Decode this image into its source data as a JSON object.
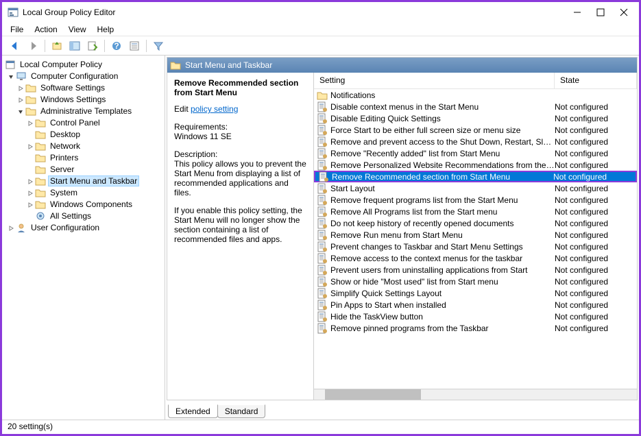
{
  "window": {
    "title": "Local Group Policy Editor"
  },
  "menu": {
    "file": "File",
    "action": "Action",
    "view": "View",
    "help": "Help"
  },
  "tree": {
    "root": "Local Computer Policy",
    "computer_config": "Computer Configuration",
    "software_settings": "Software Settings",
    "windows_settings": "Windows Settings",
    "admin_templates": "Administrative Templates",
    "control_panel": "Control Panel",
    "desktop": "Desktop",
    "network": "Network",
    "printers": "Printers",
    "server": "Server",
    "start_menu_taskbar": "Start Menu and Taskbar",
    "system": "System",
    "windows_components": "Windows Components",
    "all_settings": "All Settings",
    "user_config": "User Configuration"
  },
  "header": {
    "title": "Start Menu and Taskbar"
  },
  "desc": {
    "title": "Remove Recommended section from Start Menu",
    "edit_label": "Edit ",
    "edit_link": "policy setting",
    "req_label": "Requirements:",
    "req_value": "Windows 11 SE",
    "desc_label": "Description:",
    "desc_value": "This policy allows you to prevent the Start Menu from displaying a list of recommended applications and files.",
    "desc_value2": "If you enable this policy setting, the Start Menu will no longer show the section containing a list of recommended files and apps."
  },
  "columns": {
    "setting": "Setting",
    "state": "State"
  },
  "rows": [
    {
      "type": "folder",
      "setting": "Notifications",
      "state": ""
    },
    {
      "type": "policy",
      "setting": "Disable context menus in the Start Menu",
      "state": "Not configured"
    },
    {
      "type": "policy",
      "setting": "Disable Editing Quick Settings",
      "state": "Not configured"
    },
    {
      "type": "policy",
      "setting": "Force Start to be either full screen size or menu size",
      "state": "Not configured"
    },
    {
      "type": "policy",
      "setting": "Remove and prevent access to the Shut Down, Restart, Sleep...",
      "state": "Not configured"
    },
    {
      "type": "policy",
      "setting": "Remove \"Recently added\" list from Start Menu",
      "state": "Not configured"
    },
    {
      "type": "policy",
      "setting": "Remove Personalized Website Recommendations from the ...",
      "state": "Not configured"
    },
    {
      "type": "policy",
      "setting": "Remove Recommended section from Start Menu",
      "state": "Not configured",
      "selected": true
    },
    {
      "type": "policy",
      "setting": "Start Layout",
      "state": "Not configured"
    },
    {
      "type": "policy",
      "setting": "Remove frequent programs list from the Start Menu",
      "state": "Not configured"
    },
    {
      "type": "policy",
      "setting": "Remove All Programs list from the Start menu",
      "state": "Not configured"
    },
    {
      "type": "policy",
      "setting": "Do not keep history of recently opened documents",
      "state": "Not configured"
    },
    {
      "type": "policy",
      "setting": "Remove Run menu from Start Menu",
      "state": "Not configured"
    },
    {
      "type": "policy",
      "setting": "Prevent changes to Taskbar and Start Menu Settings",
      "state": "Not configured"
    },
    {
      "type": "policy",
      "setting": "Remove access to the context menus for the taskbar",
      "state": "Not configured"
    },
    {
      "type": "policy",
      "setting": "Prevent users from uninstalling applications from Start",
      "state": "Not configured"
    },
    {
      "type": "policy",
      "setting": "Show or hide \"Most used\" list from Start menu",
      "state": "Not configured"
    },
    {
      "type": "policy",
      "setting": "Simplify Quick Settings Layout",
      "state": "Not configured"
    },
    {
      "type": "policy",
      "setting": "Pin Apps to Start when installed",
      "state": "Not configured"
    },
    {
      "type": "policy",
      "setting": "Hide the TaskView button",
      "state": "Not configured"
    },
    {
      "type": "policy",
      "setting": "Remove pinned programs from the Taskbar",
      "state": "Not configured"
    }
  ],
  "tabs": {
    "extended": "Extended",
    "standard": "Standard"
  },
  "statusbar": "20 setting(s)"
}
